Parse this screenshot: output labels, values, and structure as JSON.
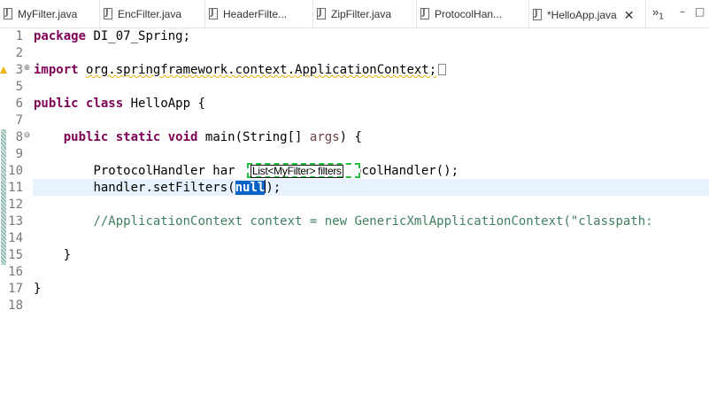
{
  "tabs": [
    {
      "label": "MyFilter.java"
    },
    {
      "label": "EncFilter.java"
    },
    {
      "label": "HeaderFilte..."
    },
    {
      "label": "ZipFilter.java"
    },
    {
      "label": "ProtocolHan..."
    },
    {
      "label": "*HelloApp.java",
      "active": true,
      "close": "✕"
    }
  ],
  "overflow": {
    "symbol": "»",
    "count": "1"
  },
  "window_controls": {
    "minimize": "–",
    "maximize": "□"
  },
  "editor": {
    "line_numbers": [
      "1",
      "2",
      "3",
      "5",
      "6",
      "7",
      "8",
      "9",
      "10",
      "11",
      "12",
      "13",
      "14",
      "15",
      "16",
      "17",
      "18"
    ],
    "line1": {
      "kw": "package",
      "rest": " DI_07_Spring;"
    },
    "line3": {
      "kw": "import",
      "rest": "org.springframework.context.ApplicationContext;"
    },
    "line6": {
      "kw1": "public",
      "kw2": "class",
      "rest": " HelloApp {"
    },
    "line8": {
      "kw1": "public",
      "kw2": "static",
      "kw3": "void",
      "rest_a": " main(String[] ",
      "param": "args",
      "rest_b": ") {"
    },
    "line10": {
      "before": "ProtocolHandler har",
      "after": "tocolHandler();"
    },
    "line10_popup": "List<MyFilter> filters",
    "line11": {
      "before": "handler.setFilters(",
      "selected": "null",
      "after": ");"
    },
    "line13": {
      "comment_a": "//ApplicationContext context = new GenericXmlApplicationContext(",
      "comment_str": "\"classpath:"
    },
    "line15": "}",
    "line17": "}"
  },
  "colors": {
    "keyword": "#7f0055",
    "comment": "#3f7f5f",
    "current_line": "#e8f2fe",
    "selection": "#0a64c8",
    "linked_mode_border": "#1fbf3f"
  }
}
